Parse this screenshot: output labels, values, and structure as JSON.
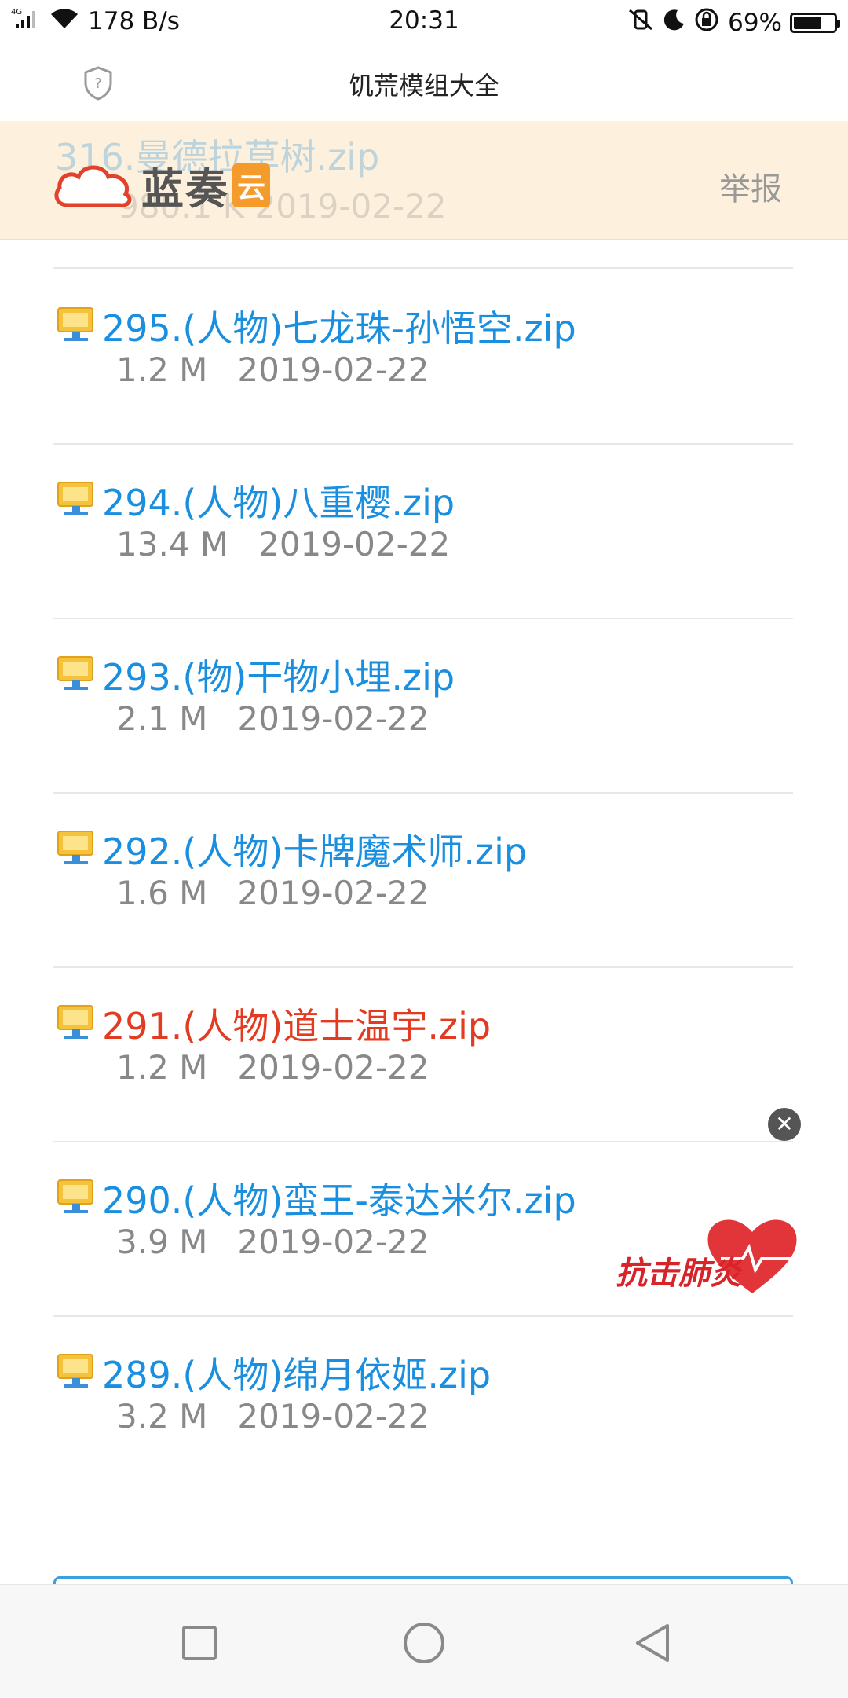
{
  "status_bar": {
    "network_type": "4G",
    "speed": "178 B/s",
    "time": "20:31",
    "battery": "69%",
    "battery_level": 0.69
  },
  "app_bar": {
    "title": "饥荒模组大全"
  },
  "banner": {
    "faded_file_name": "316.曼德拉草树.zip",
    "faded_file_meta": "980.1 K   2019-02-22",
    "logo_text": "蓝奏",
    "logo_tag": "云",
    "report_label": "举报"
  },
  "files": [
    {
      "name": "295.(人物)七龙珠-孙悟空.zip",
      "size": "1.2 M",
      "date": "2019-02-22",
      "color": "#1a8fe0"
    },
    {
      "name": "294.(人物)八重樱.zip",
      "size": "13.4 M",
      "date": "2019-02-22",
      "color": "#1a8fe0"
    },
    {
      "name": "293.(物)干物小埋.zip",
      "size": "2.1 M",
      "date": "2019-02-22",
      "color": "#1a8fe0"
    },
    {
      "name": "292.(人物)卡牌魔术师.zip",
      "size": "1.6 M",
      "date": "2019-02-22",
      "color": "#1a8fe0"
    },
    {
      "name": "291.(人物)道士温宇.zip",
      "size": "1.2 M",
      "date": "2019-02-22",
      "color": "#e33b21"
    },
    {
      "name": "290.(人物)蛮王-泰达米尔.zip",
      "size": "3.9 M",
      "date": "2019-02-22",
      "color": "#1a8fe0"
    },
    {
      "name": "289.(人物)绵月依姬.zip",
      "size": "3.2 M",
      "date": "2019-02-22",
      "color": "#1a8fe0"
    }
  ],
  "floating": {
    "close_symbol": "✕",
    "promo_text": "抗击肺炎"
  }
}
